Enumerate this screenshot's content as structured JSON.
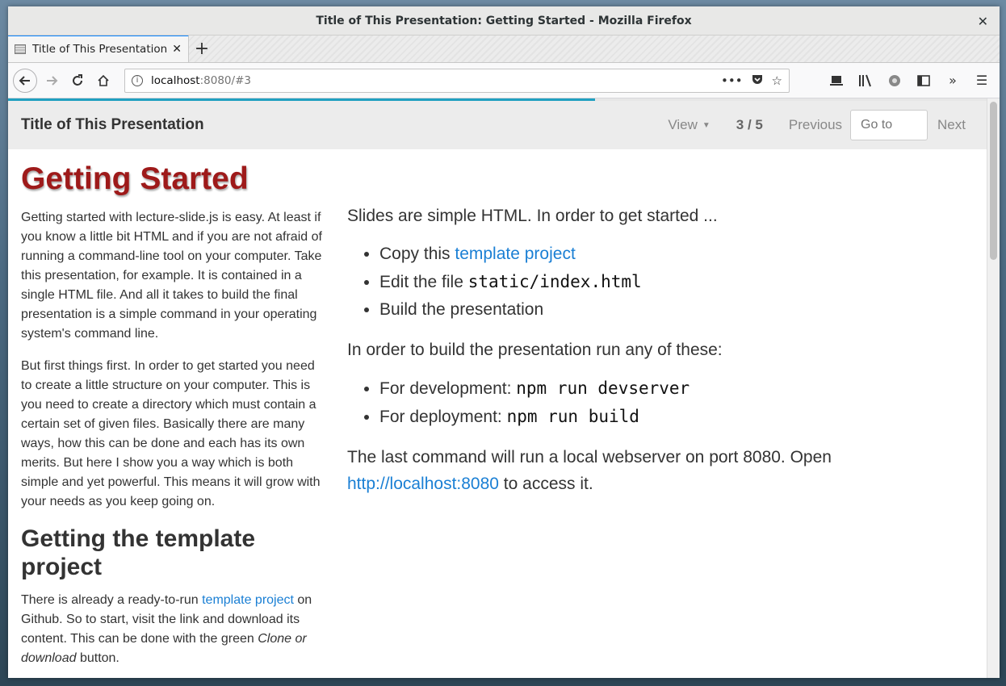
{
  "window": {
    "title": "Title of This Presentation: Getting Started - Mozilla Firefox",
    "close_glyph": "✕"
  },
  "tab": {
    "label": "Title of This Presentation",
    "close_glyph": "✕"
  },
  "newtab": {
    "glyph": "+"
  },
  "nav": {
    "url_host": "localhost",
    "url_path": ":8080/#3"
  },
  "presentation": {
    "title": "Title of This Presentation",
    "view_label": "View",
    "counter": "3 / 5",
    "previous_label": "Previous",
    "goto_placeholder": "Go to",
    "next_label": "Next",
    "progress_fraction": 0.6
  },
  "slide": {
    "heading": "Getting Started",
    "left_p1": "Getting started with lecture-slide.js is easy. At least if you know a little bit HTML and if you are not afraid of running a command-line tool on your computer. Take this presentation, for example. It is contained in a single HTML file. And all it takes to build the final presentation is a simple command in your operating system's command line.",
    "left_p2": "But first things first. In order to get started you need to create a little structure on your computer. This is you need to create a directory which must contain a certain set of given files. Basically there are many ways, how this can be done and each has its own merits. But here I show you a way which is both simple and yet powerful. This means it will grow with your needs as you keep going on.",
    "subheading": "Getting the template project",
    "left_p3_before": "There is already a ready-to-run ",
    "left_p3_link": "template project",
    "left_p3_middle": " on Github. So to start, visit the link and download its content. This can be done with the green ",
    "left_p3_em": "Clone or download",
    "left_p3_after": " button.",
    "right_intro": "Slides are simple HTML. In order to get started ...",
    "list1": [
      {
        "before": "Copy this ",
        "link": "template project",
        "code": ""
      },
      {
        "before": "Edit the file ",
        "link": "",
        "code": "static/index.html"
      },
      {
        "before": "Build the presentation",
        "link": "",
        "code": ""
      }
    ],
    "right_mid": "In order to build the presentation run any of these:",
    "list2": [
      {
        "before": "For development: ",
        "code": "npm run devserver"
      },
      {
        "before": "For deployment: ",
        "code": "npm run build"
      }
    ],
    "right_end_before": "The last command will run a local webserver on port 8080. Open ",
    "right_end_link": "http://localhost:8080",
    "right_end_after": " to access it."
  }
}
